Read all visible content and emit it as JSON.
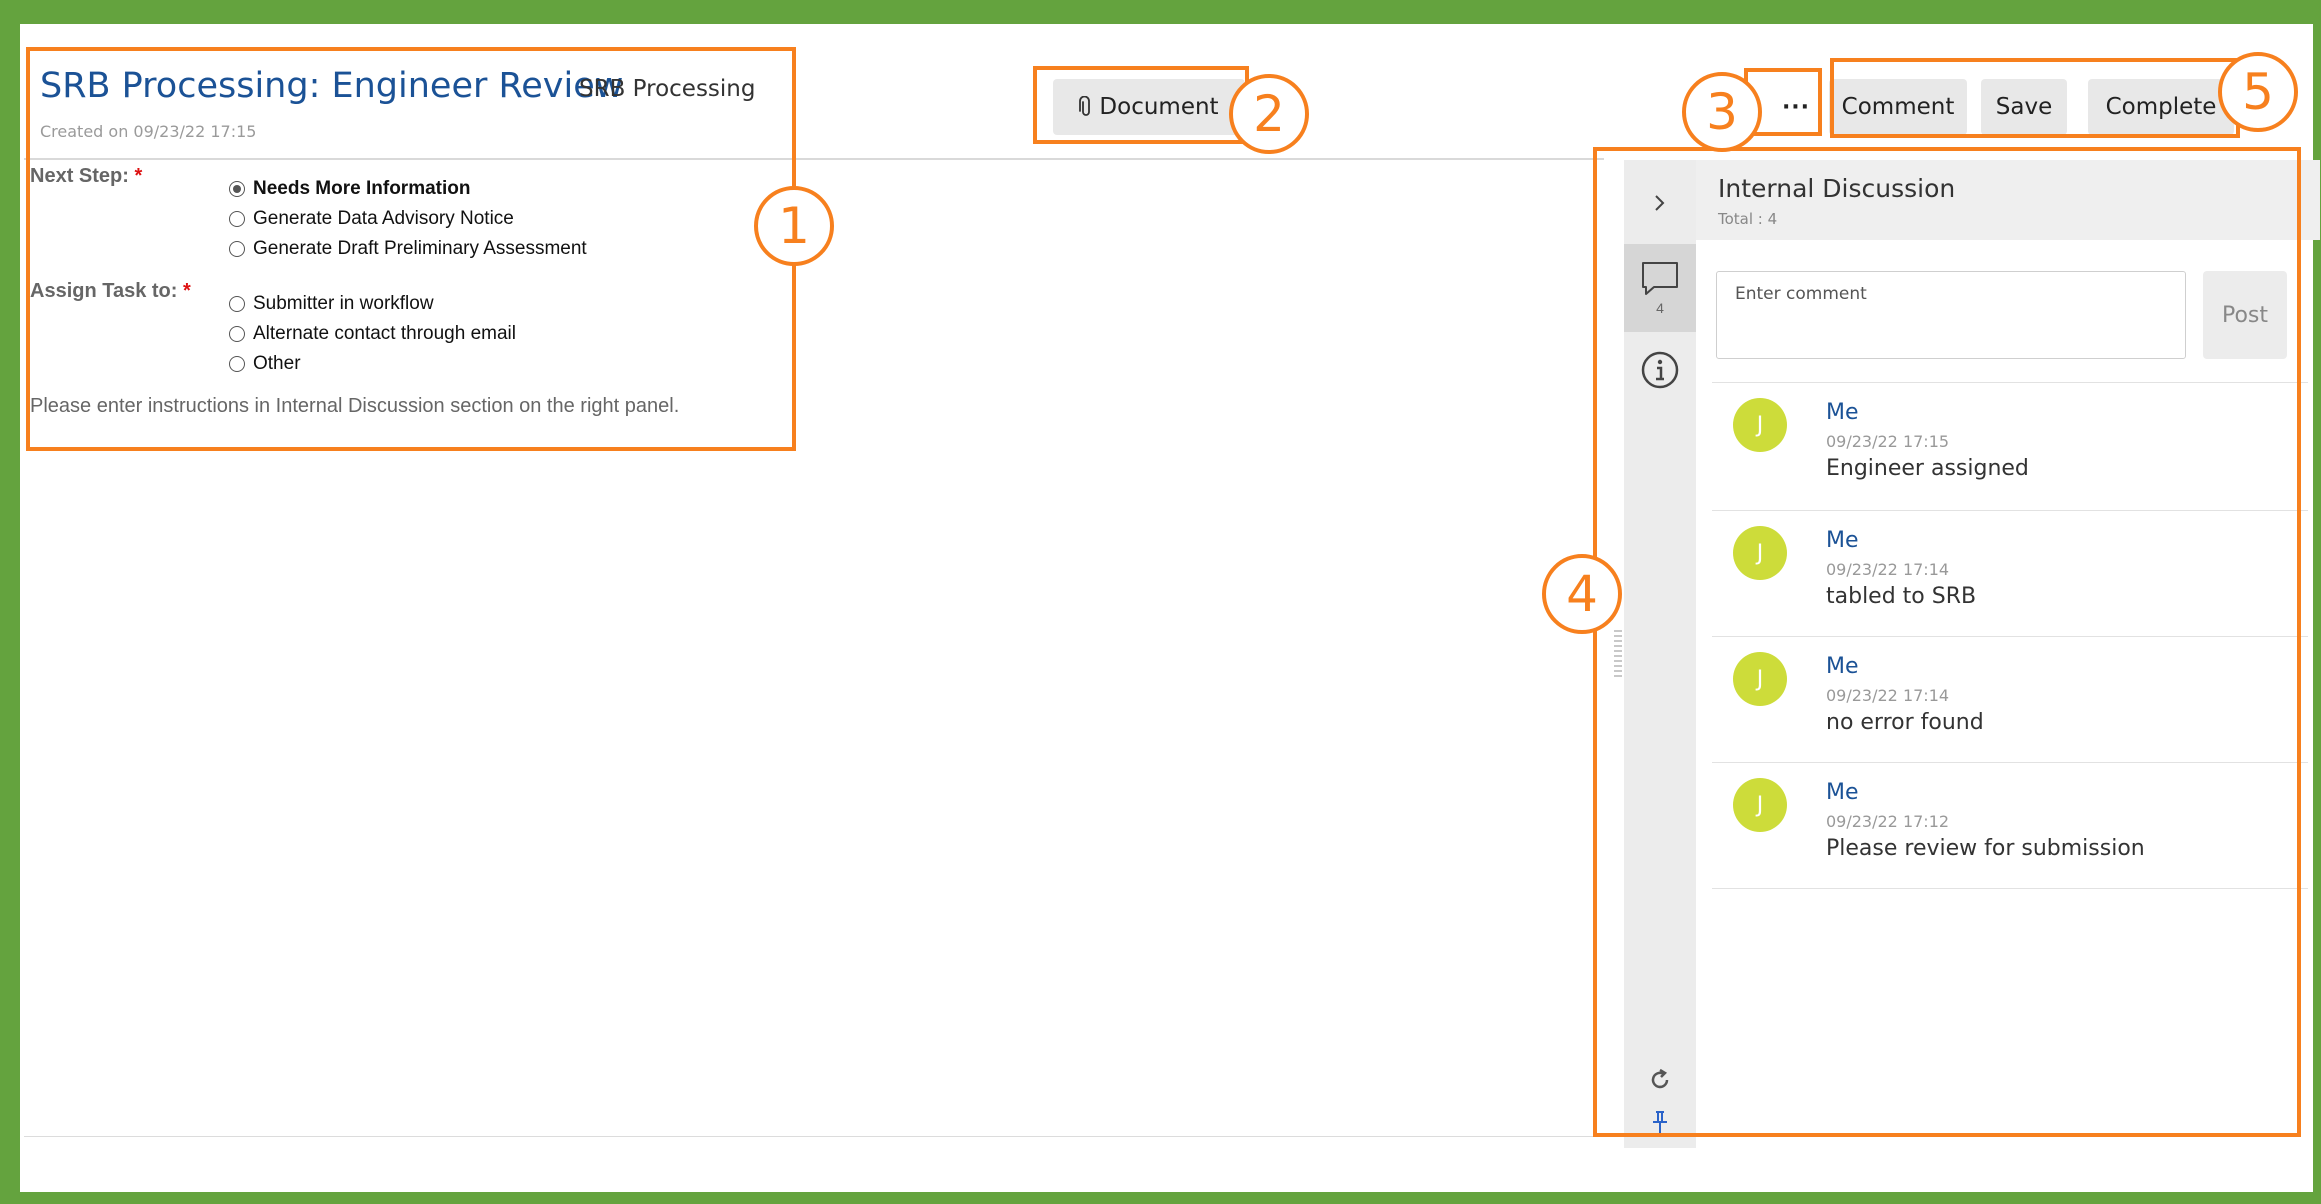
{
  "header": {
    "title": "SRB Processing: Engineer Review",
    "subtitle": "SRB Processing",
    "created": "Created on 09/23/22 17:15"
  },
  "toolbar": {
    "document_label": "Document",
    "more_label": "···",
    "comment_label": "Comment",
    "save_label": "Save",
    "complete_label": "Complete"
  },
  "form": {
    "next_step_label": "Next Step:",
    "next_step_options": [
      "Needs More Information",
      "Generate Data Advisory Notice",
      "Generate Draft Preliminary Assessment"
    ],
    "next_step_selected": "Needs More Information",
    "assign_label": "Assign Task to:",
    "assign_options": [
      "Submitter in workflow",
      "Alternate contact through email",
      "Other"
    ],
    "required_mark": "*",
    "instructions": "Please enter instructions in Internal Discussion section on the right panel."
  },
  "panel": {
    "title": "Internal Discussion",
    "total": "Total : 4",
    "comment_count": "4",
    "input_placeholder": "Enter comment",
    "post_label": "Post",
    "comments": [
      {
        "avatar": "J",
        "author": "Me",
        "time": "09/23/22 17:15",
        "text": "Engineer assigned"
      },
      {
        "avatar": "J",
        "author": "Me",
        "time": "09/23/22 17:14",
        "text": "tabled to SRB"
      },
      {
        "avatar": "J",
        "author": "Me",
        "time": "09/23/22 17:14",
        "text": "no error found"
      },
      {
        "avatar": "J",
        "author": "Me",
        "time": "09/23/22 17:12",
        "text": "Please review for submission"
      }
    ]
  },
  "annotations": [
    "1",
    "2",
    "3",
    "4",
    "5"
  ],
  "colors": {
    "frame": "#64a33e",
    "callout": "#f7801e",
    "title_blue": "#1b5296",
    "avatar": "#cddc3a"
  },
  "icons": {
    "document": "paperclip-icon",
    "collapse": "chevron-right-icon",
    "comments": "speech-bubble-icon",
    "info": "info-icon",
    "refresh": "refresh-icon",
    "pin": "pin-icon"
  }
}
